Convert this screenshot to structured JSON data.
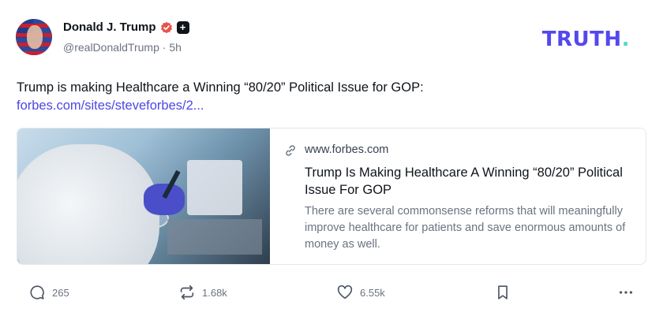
{
  "author": {
    "display_name": "Donald J. Trump",
    "handle": "@realDonaldTrump",
    "separator": "·",
    "time_ago": "5h",
    "badge_plus": "+"
  },
  "brand": {
    "logo_text": "TRUTH",
    "logo_dot": ".",
    "logo_color": "#5448ee",
    "dot_color": "#56d6c5"
  },
  "post": {
    "text": "Trump is making Healthcare a Winning “80/20” Political Issue for GOP:",
    "link": "forbes.com/sites/steveforbes/2..."
  },
  "card": {
    "domain": "www.forbes.com",
    "title": "Trump Is Making Healthcare A Winning “80/20” Political Issue For GOP",
    "description": "There are several commonsense reforms that will meaningfully improve healthcare for patients and save enormous amounts of money as well.",
    "link_icon": "link-icon",
    "image_icon": "lab-photo"
  },
  "actions": {
    "replies": "265",
    "retruths": "1.68k",
    "likes": "6.55k",
    "reply_icon": "comment-icon",
    "retruth_icon": "repost-icon",
    "like_icon": "heart-icon",
    "bookmark_icon": "bookmark-icon",
    "more_icon": "more-icon"
  },
  "colors": {
    "link": "#4f46e5",
    "verified": "#e5534b",
    "muted": "#6b7280"
  }
}
